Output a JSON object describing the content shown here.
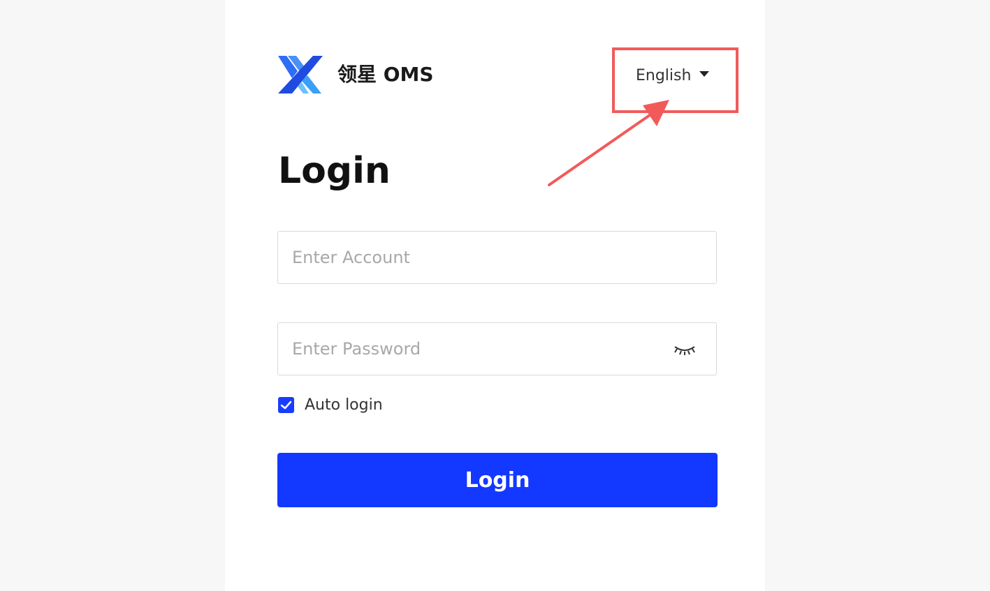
{
  "brand": {
    "name": "领星 OMS",
    "logo_icon": "lingxing-x-logo-icon"
  },
  "language": {
    "selected": "English",
    "caret_icon": "caret-down-icon"
  },
  "login": {
    "title": "Login",
    "account_placeholder": "Enter Account",
    "password_placeholder": "Enter Password",
    "password_toggle_icon": "eye-closed-icon",
    "auto_login_label": "Auto login",
    "auto_login_checked": true,
    "submit_label": "Login"
  },
  "colors": {
    "primary": "#1338ff",
    "annotation": "#f25a5a"
  }
}
